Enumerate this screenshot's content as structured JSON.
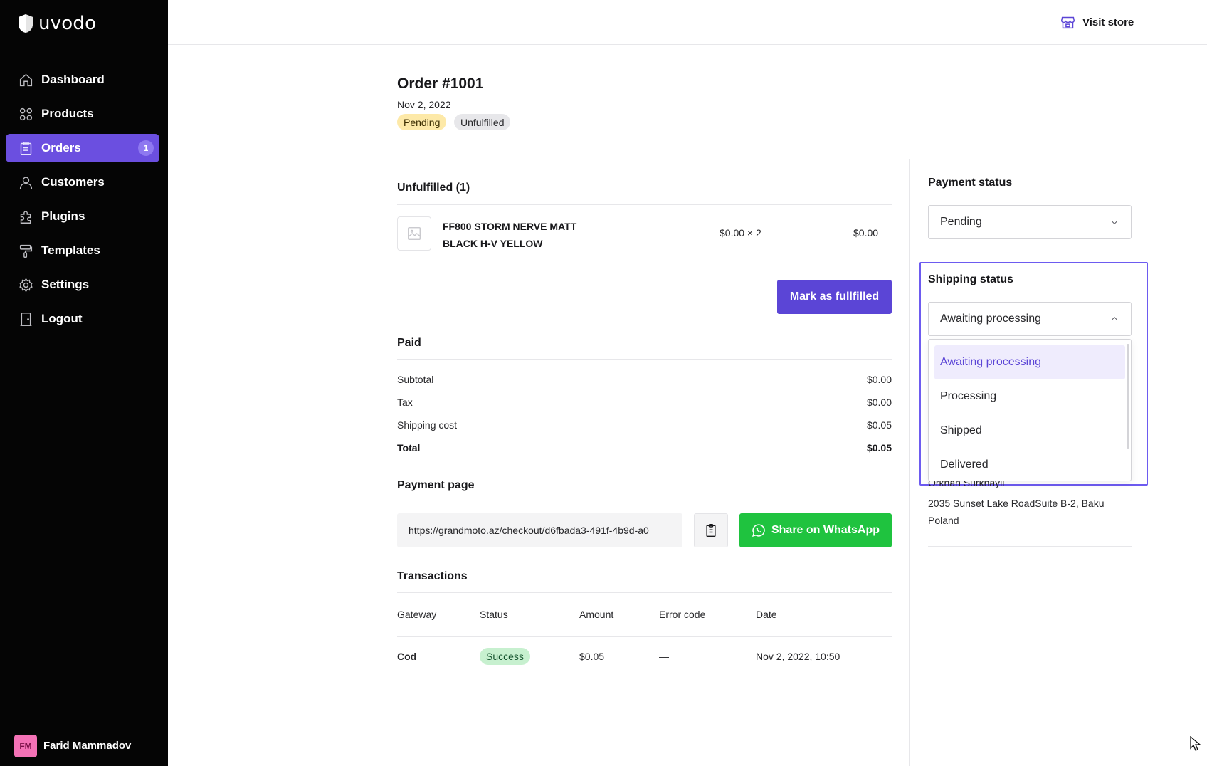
{
  "app": {
    "logo_text": "uvodo"
  },
  "sidebar": {
    "items": [
      {
        "label": "Dashboard",
        "icon": "home-icon"
      },
      {
        "label": "Products",
        "icon": "grid-icon"
      },
      {
        "label": "Orders",
        "icon": "clipboard-icon",
        "badge": "1",
        "active": true
      },
      {
        "label": "Customers",
        "icon": "user-icon"
      },
      {
        "label": "Plugins",
        "icon": "puzzle-icon"
      },
      {
        "label": "Templates",
        "icon": "paint-roller-icon"
      },
      {
        "label": "Settings",
        "icon": "gear-icon"
      },
      {
        "label": "Logout",
        "icon": "door-icon"
      }
    ],
    "user": {
      "initials": "FM",
      "name": "Farid Mammadov"
    }
  },
  "topbar": {
    "visit_store": "Visit store"
  },
  "order": {
    "title": "Order #1001",
    "date": "Nov 2, 2022",
    "payment_pill": "Pending",
    "fulfillment_pill": "Unfulfilled"
  },
  "unfulfilled": {
    "title": "Unfulfilled (1)",
    "product_name": "FF800 STORM NERVE MATT BLACK H-V YELLOW",
    "unit_qty": "$0.00 × 2",
    "line_total": "$0.00",
    "mark_button": "Mark as fullfilled"
  },
  "paid": {
    "title": "Paid",
    "rows": [
      {
        "label": "Subtotal",
        "value": "$0.00"
      },
      {
        "label": "Tax",
        "value": "$0.00"
      },
      {
        "label": "Shipping cost",
        "value": "$0.05"
      },
      {
        "label": "Total",
        "value": "$0.05"
      }
    ]
  },
  "payment_page": {
    "title": "Payment page",
    "url": "https://grandmoto.az/checkout/d6fbada3-491f-4b9d-a0",
    "whatsapp_button": "Share on WhatsApp"
  },
  "transactions": {
    "title": "Transactions",
    "headers": [
      "Gateway",
      "Status",
      "Amount",
      "Error code",
      "Date"
    ],
    "rows": [
      {
        "gateway": "Cod",
        "status": "Success",
        "amount": "$0.05",
        "error_code": "—",
        "date": "Nov 2, 2022, 10:50"
      }
    ]
  },
  "right_panel": {
    "payment_status_title": "Payment status",
    "payment_status_value": "Pending",
    "shipping_status_title": "Shipping status",
    "shipping_status_value": "Awaiting processing",
    "shipping_options": [
      "Awaiting processing",
      "Processing",
      "Shipped",
      "Delivered"
    ],
    "address_name": "Orkhan Surkhayli",
    "address_line1": "2035 Sunset Lake RoadSuite B-2, Baku",
    "address_line2": "Poland"
  },
  "colors": {
    "accent": "#5b45d6",
    "sidebar_bg": "#050505",
    "whatsapp": "#1fc33f",
    "pending": "#fde9a8",
    "success": "#c7f0cf"
  }
}
